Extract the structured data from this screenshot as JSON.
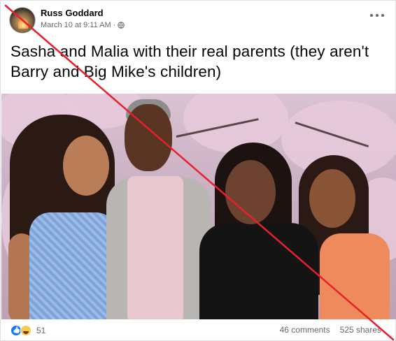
{
  "post": {
    "author": "Russ Goddard",
    "date": "March 10 at 9:11 AM",
    "separator": "·",
    "privacy_icon": "globe-icon",
    "more_icon": "ellipsis-icon",
    "text": "Sasha and Malia with their real parents (they aren't Barry and Big Mike's children)"
  },
  "overlay": {
    "color": "#e8202b",
    "description_icon": "red-strike-line"
  },
  "footer": {
    "reaction_icons": [
      "like-icon",
      "haha-icon"
    ],
    "reaction_count": "51",
    "comments": "46 comments",
    "shares": "525 shares"
  }
}
